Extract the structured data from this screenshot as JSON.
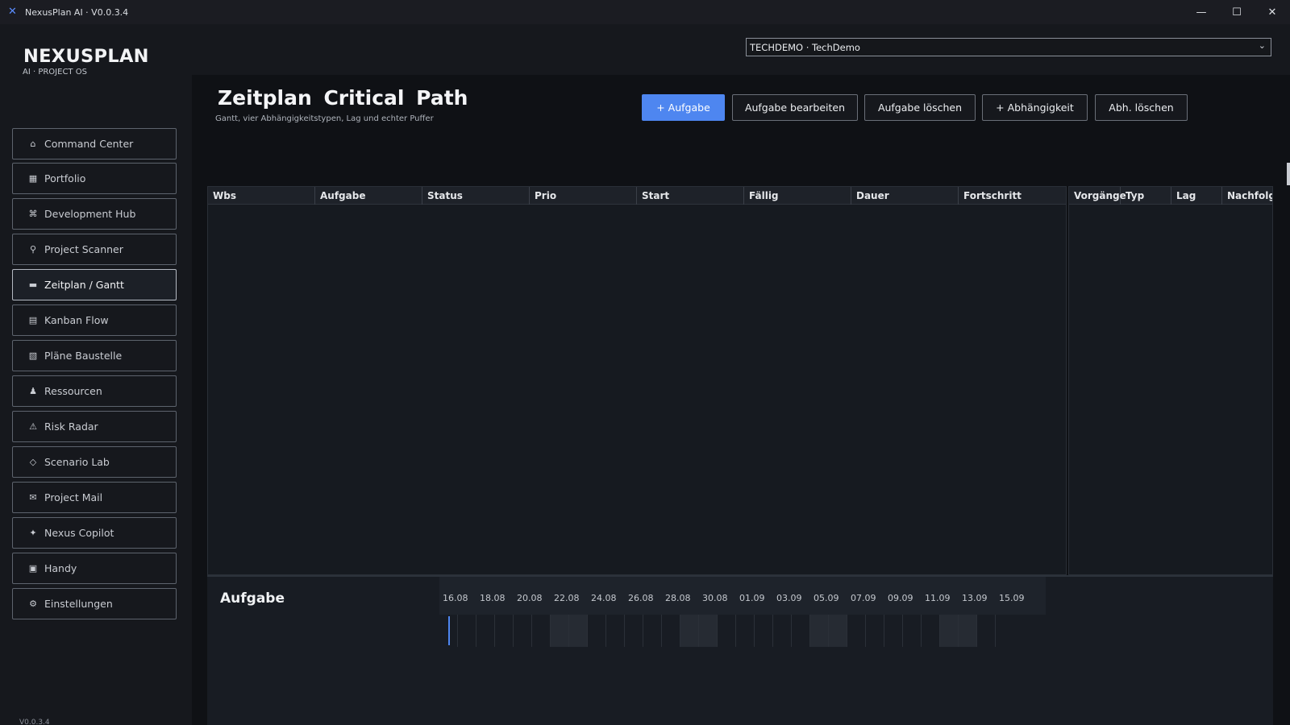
{
  "window": {
    "title": "NexusPlan AI · V0.0.3.4"
  },
  "brand": {
    "name": "NEXUSPLAN",
    "tagline": "AI · PROJECT OS",
    "version": "V0.0.3.4"
  },
  "project_select": {
    "value": "TECHDEMO · TechDemo"
  },
  "nav": [
    {
      "label": "Command Center",
      "icon": "home-icon",
      "glyph": "⌂"
    },
    {
      "label": "Portfolio",
      "icon": "grid-icon",
      "glyph": "▦"
    },
    {
      "label": "Development Hub",
      "icon": "command-icon",
      "glyph": "⌘"
    },
    {
      "label": "Project Scanner",
      "icon": "search-icon",
      "glyph": "⚲"
    },
    {
      "label": "Zeitplan / Gantt",
      "icon": "timeline-icon",
      "glyph": "▬",
      "active": true
    },
    {
      "label": "Kanban Flow",
      "icon": "board-icon",
      "glyph": "▤"
    },
    {
      "label": "Pläne  Baustelle",
      "icon": "blueprint-icon",
      "glyph": "▧"
    },
    {
      "label": "Ressourcen",
      "icon": "person-icon",
      "glyph": "♟"
    },
    {
      "label": "Risk Radar",
      "icon": "warning-icon",
      "glyph": "⚠"
    },
    {
      "label": "Scenario Lab",
      "icon": "diamond-icon",
      "glyph": "◇"
    },
    {
      "label": "Project Mail",
      "icon": "mail-icon",
      "glyph": "✉"
    },
    {
      "label": "Nexus Copilot",
      "icon": "sparkle-icon",
      "glyph": "✦"
    },
    {
      "label": "Handy",
      "icon": "phone-icon",
      "glyph": "▣"
    },
    {
      "label": "Einstellungen",
      "icon": "gear-icon",
      "glyph": "⚙"
    }
  ],
  "page": {
    "title": "Zeitplan  Critical Path",
    "subtitle": "Gantt, vier Abhängigkeitstypen, Lag und echter Puffer"
  },
  "actions": {
    "add_task": "+ Aufgabe",
    "edit_task": "Aufgabe bearbeiten",
    "delete_task": "Aufgabe löschen",
    "add_dependency": "+ Abhängigkeit",
    "delete_dependency": "Abh. löschen"
  },
  "task_table": {
    "columns": [
      "Wbs",
      "Aufgabe",
      "Status",
      "Prio",
      "Start",
      "Fällig",
      "Dauer",
      "Fortschritt"
    ]
  },
  "dependency_table": {
    "columns": [
      "Vorgänge",
      "Typ",
      "Lag",
      "Nachfolge"
    ]
  },
  "gantt": {
    "label": "Aufgabe",
    "dates": [
      "16.08",
      "18.08",
      "20.08",
      "22.08",
      "24.08",
      "26.08",
      "28.08",
      "30.08",
      "01.09",
      "03.09",
      "05.09",
      "07.09",
      "09.09",
      "11.09",
      "13.09",
      "15.09"
    ]
  },
  "colors": {
    "accent": "#4e86f0",
    "background": "#0f1115",
    "panel": "#161a20"
  }
}
